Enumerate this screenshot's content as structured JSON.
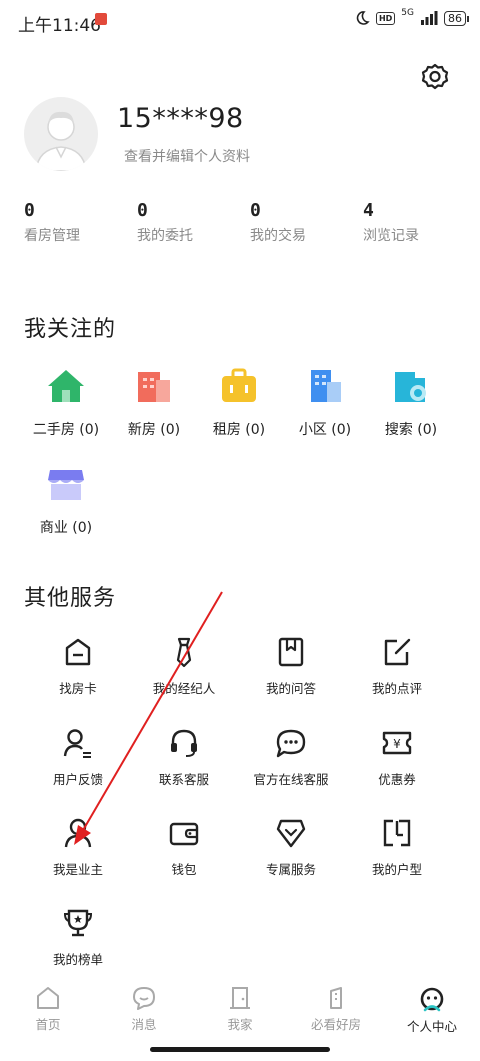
{
  "status_bar": {
    "time": "上午11:46",
    "network": "5G",
    "battery": "86"
  },
  "profile": {
    "username": "15****98",
    "edit_link": "查看并编辑个人资料"
  },
  "stats": [
    {
      "value": "0",
      "label": "看房管理"
    },
    {
      "value": "0",
      "label": "我的委托"
    },
    {
      "value": "0",
      "label": "我的交易"
    },
    {
      "value": "4",
      "label": "浏览记录"
    }
  ],
  "following": {
    "title": "我关注的",
    "items": [
      {
        "label": "二手房 (0)",
        "icon": "house-icon",
        "color": "#2fb56a"
      },
      {
        "label": "新房 (0)",
        "icon": "building-icon",
        "color": "#f16c5c"
      },
      {
        "label": "租房 (0)",
        "icon": "suitcase-icon",
        "color": "#f5c22b"
      },
      {
        "label": "小区 (0)",
        "icon": "community-icon",
        "color": "#3f8ff0"
      },
      {
        "label": "搜索 (0)",
        "icon": "search-icon",
        "color": "#27b5d9"
      },
      {
        "label": "商业 (0)",
        "icon": "shop-icon",
        "color": "#7a7cf0"
      }
    ]
  },
  "services": {
    "title": "其他服务",
    "items": [
      {
        "label": "找房卡",
        "icon": "house-card-icon"
      },
      {
        "label": "我的经纪人",
        "icon": "tie-icon"
      },
      {
        "label": "我的问答",
        "icon": "bookmark-icon"
      },
      {
        "label": "我的点评",
        "icon": "edit-icon"
      },
      {
        "label": "用户反馈",
        "icon": "user-feedback-icon"
      },
      {
        "label": "联系客服",
        "icon": "headset-icon"
      },
      {
        "label": "官方在线客服",
        "icon": "chat-bubble-icon"
      },
      {
        "label": "优惠券",
        "icon": "coupon-icon"
      },
      {
        "label": "我是业主",
        "icon": "owner-icon"
      },
      {
        "label": "钱包",
        "icon": "wallet-icon"
      },
      {
        "label": "专属服务",
        "icon": "exclusive-service-icon"
      },
      {
        "label": "我的户型",
        "icon": "floorplan-icon"
      },
      {
        "label": "我的榜单",
        "icon": "trophy-icon"
      }
    ]
  },
  "tabbar": [
    {
      "label": "首页",
      "icon": "home-icon",
      "active": false
    },
    {
      "label": "消息",
      "icon": "message-icon",
      "active": false
    },
    {
      "label": "我家",
      "icon": "door-icon",
      "active": false
    },
    {
      "label": "必看好房",
      "icon": "tower-icon",
      "active": false
    },
    {
      "label": "个人中心",
      "icon": "profile-face-icon",
      "active": true
    }
  ],
  "colors": {
    "accent": "#e02020",
    "text": "#1f1f1f",
    "muted": "#8a8a8a",
    "active_tab_cyan": "#2bc4c4"
  }
}
